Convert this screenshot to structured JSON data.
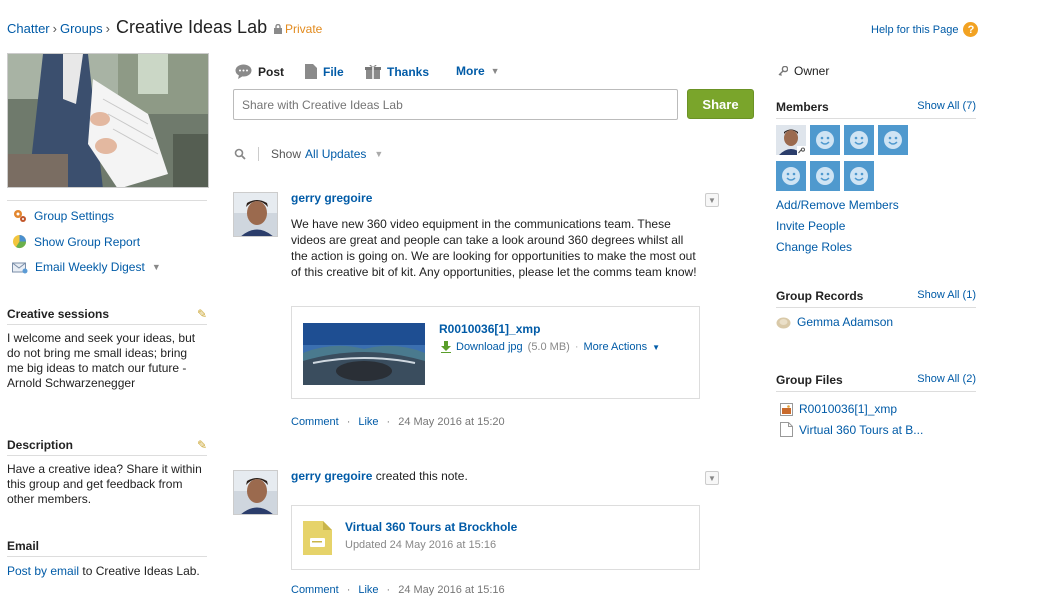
{
  "breadcrumb": [
    "Chatter",
    "Groups"
  ],
  "group": {
    "title": "Creative Ideas Lab",
    "privacy": "Private"
  },
  "help": {
    "label": "Help for this Page",
    "icon": "help-icon"
  },
  "left": {
    "actions": [
      {
        "label": "Group Settings",
        "icon": "settings-icon"
      },
      {
        "label": "Show Group Report",
        "icon": "report-icon"
      },
      {
        "label": "Email Weekly Digest",
        "icon": "email-icon"
      }
    ],
    "info_title": "Creative sessions",
    "info_text": "I welcome and seek your ideas, but do not bring me small ideas; bring me big ideas to match our future - Arnold Schwarzenegger",
    "description_title": "Description",
    "description_text": "Have a creative idea? Share it within this group and get feedback from other members.",
    "email_title": "Email",
    "email_link": "Post by email",
    "email_suffix": " to Creative Ideas Lab."
  },
  "publisher": {
    "tabs": [
      "Post",
      "File",
      "Thanks",
      "More"
    ],
    "placeholder": "Share with Creative Ideas Lab",
    "share": "Share",
    "filter_prefix": "Show",
    "filter_value": "All Updates"
  },
  "feed": [
    {
      "author": "gerry gregoire",
      "body": "We have new 360 video equipment in the communications team. These videos are great and people can take a look around 360 degrees whilst all the action is going on. We are looking for opportunities to make the most out of this creative bit of kit. Any opportunities, please let the comms team know!",
      "attachment": {
        "name": "R0010036[1]_xmp",
        "download": "Download jpg",
        "size": "(5.0 MB)",
        "more": "More Actions"
      },
      "actions": [
        "Comment",
        "Like"
      ],
      "timestamp": "24 May 2016 at 15:20"
    },
    {
      "author": "gerry gregoire",
      "verb": "created this note.",
      "note": {
        "title": "Virtual 360 Tours at Brockhole",
        "updated": "Updated 24 May 2016 at 15:16"
      },
      "actions": [
        "Comment",
        "Like"
      ],
      "timestamp": "24 May 2016 at 15:16"
    }
  ],
  "right": {
    "owner": "Owner",
    "members_title": "Members",
    "members_showall": "Show All (7)",
    "member_links": [
      "Add/Remove Members",
      "Invite People",
      "Change Roles"
    ],
    "records_title": "Group Records",
    "records_showall": "Show All (1)",
    "record_name": "Gemma Adamson",
    "files_title": "Group Files",
    "files_showall": "Show All (2)",
    "files": [
      "R0010036[1]_xmp",
      "Virtual 360 Tours at B..."
    ]
  },
  "colors": {
    "link": "#015ba7",
    "share_button": "#7aa52b",
    "private": "#e28a1d",
    "member_tile": "#4f99ce"
  }
}
